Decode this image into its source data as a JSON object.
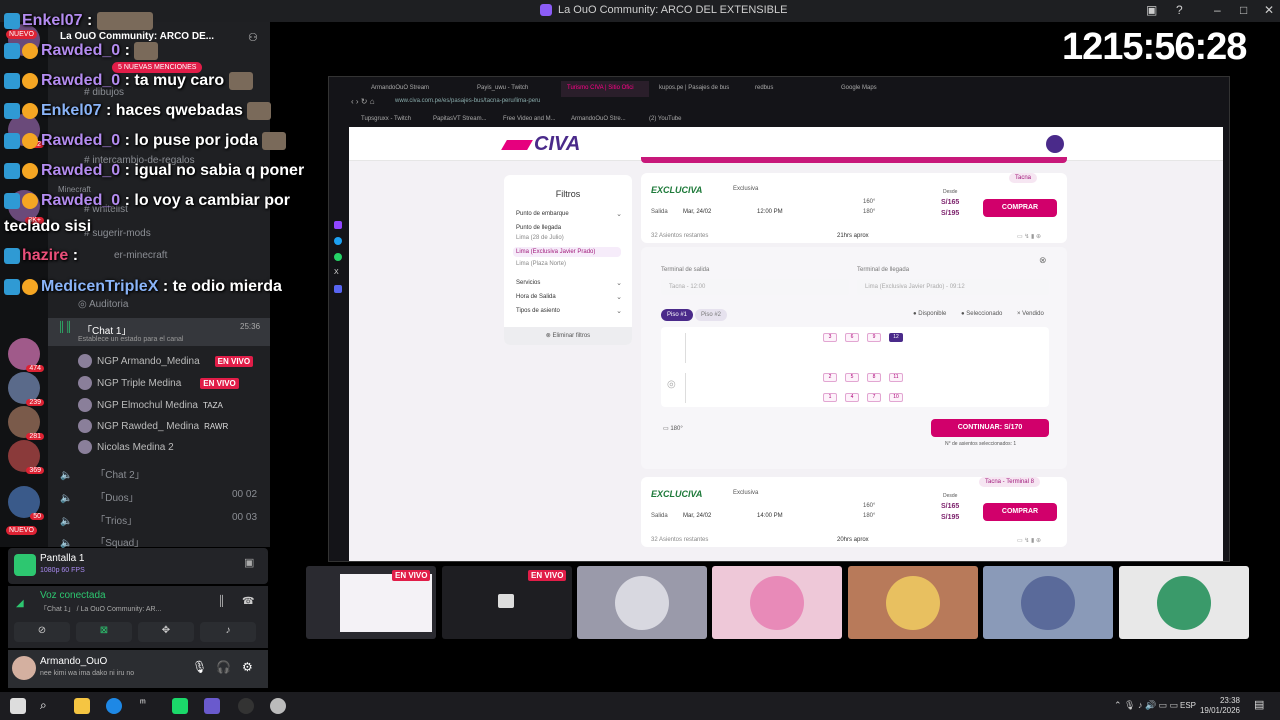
{
  "window": {
    "title": "La OuO Community: ARCO DEL EXTENSIBLE"
  },
  "timer": "1215:56:28",
  "discord": {
    "server_title": "La OuO Community: ARCO DE...",
    "new_badge": "NUEVO",
    "mentions_badge": "5 NUEVAS MENCIONES",
    "channels": [
      "dibujos",
      "intercambio-de-regalos",
      "Minecraft",
      "whitelist",
      "sugerir-mods",
      "er-minecraft",
      "Auditoria"
    ],
    "voice_channel": {
      "name": "「Chat 1」",
      "time": "25:36",
      "status_hint": "Establece un estado para el canal"
    },
    "members": [
      {
        "name": "NGP Armando_Medina",
        "badge": "EN VIVO"
      },
      {
        "name": "NGP Triple Medina",
        "badge": "EN VIVO"
      },
      {
        "name": "NGP Elmochul Medina",
        "tag": "TAZA"
      },
      {
        "name": "NGP Rawded_ Medina",
        "tag": "RAWR"
      },
      {
        "name": "Nicolas Medina 2"
      }
    ],
    "other_channels": [
      {
        "name": "「Chat 2」"
      },
      {
        "name": "「Duos」",
        "count_a": "00",
        "count_b": "02"
      },
      {
        "name": "「Trios」",
        "count_a": "00",
        "count_b": "03"
      },
      {
        "name": "「Squad」"
      }
    ],
    "server_counts": [
      "42",
      "3K+",
      "474",
      "239",
      "281",
      "369",
      "50"
    ],
    "screen_share": {
      "title": "Pantalla 1",
      "quality": "1080p 60 FPS"
    },
    "voice": {
      "status": "Voz conectada",
      "channel": "「Chat 1」 / La OuO Community: AR..."
    },
    "user": {
      "name": "Armando_OuO",
      "status": "nee kimi wa ima dako ni iru no"
    }
  },
  "chat": [
    {
      "user": "Enkel07",
      "text": ":"
    },
    {
      "user": "Rawded_0",
      "text": ":"
    },
    {
      "user": "Rawded_0",
      "text": ": ta muy caro"
    },
    {
      "user": "Enkel07",
      "text": ": haces qwebadas"
    },
    {
      "user": "Rawded_0",
      "text": ": lo puse por joda"
    },
    {
      "user": "Rawded_0",
      "text": ": igual no sabia q poner"
    },
    {
      "user": "Rawded_0",
      "text": ": lo voy a cambiar por"
    },
    {
      "user": "",
      "text": "teclado sisi"
    },
    {
      "user": "hazire",
      "text": ":"
    },
    {
      "user": "MedicenTripleX",
      "text": ": te odio mierda"
    }
  ],
  "browser": {
    "tabs": [
      "ArmandoOuO Stream",
      "Payis_uwu - Twitch",
      "Turismo CIVA | Sitio Ofici",
      "kupos.pe | Pasajes de bus",
      "redbus",
      "Google Maps"
    ],
    "url": "www.civa.com.pe/es/pasajes-bus/tacna-peru/lima-peru",
    "bookmarks": [
      "Tupsgruxx - Twitch",
      "PapitasVT Stream...",
      "Free Video and M...",
      "ArmandoOuO Stre...",
      "(2) YouTube"
    ]
  },
  "civa": {
    "logo": "CIVA",
    "filters": {
      "title": "Filtros",
      "boarding": "Punto de embarque",
      "arrival": "Punto de llegada",
      "options": [
        "Lima (28 de Julio)",
        "Lima (Exclusiva Javier Prado)",
        "Lima (Plaza Norte)"
      ],
      "services": "Servicios",
      "departure_time": "Hora de Salida",
      "seat_type": "Tipos de asiento",
      "clear": "Eliminar filtros"
    },
    "trips": [
      {
        "brand": "EXCLUCIVA",
        "service": "Exclusiva",
        "origin_tag": "Tacna",
        "depart_label": "Salida",
        "date": "Mar, 24/02",
        "time": "12:00 PM",
        "seat_a": "160°",
        "seat_b": "180°",
        "from_label": "Desde",
        "price_a": "S/165",
        "price_b": "S/195",
        "buy": "COMPRAR",
        "seats_left": "32 Asientos restantes",
        "duration": "21hrs aprox"
      },
      {
        "brand": "EXCLUCIVA",
        "service": "Exclusiva",
        "origin_tag": "Tacna - Terminal 8",
        "depart_label": "Salida",
        "date": "Mar, 24/02",
        "time": "14:00 PM",
        "seat_a": "160°",
        "seat_b": "180°",
        "from_label": "Desde",
        "price_a": "S/165",
        "price_b": "S/195",
        "buy": "COMPRAR",
        "seats_left": "32 Asientos restantes",
        "duration": "20hrs aprox"
      }
    ],
    "seat_picker": {
      "from_label": "Terminal de salida",
      "from_value": "Tacna - 12:00",
      "to_label": "Terminal de llegada",
      "to_value": "Lima (Exclusiva Javier Prado) - 09:12",
      "floor1": "Piso #1",
      "floor2": "Piso #2",
      "legend": [
        "Disponible",
        "Seleccionado",
        "Vendido"
      ],
      "seat_numbers_top": [
        "3",
        "6",
        "9",
        "12"
      ],
      "seat_numbers_mid": [
        "2",
        "5",
        "8",
        "11"
      ],
      "seat_numbers_bot": [
        "1",
        "4",
        "7",
        "10"
      ],
      "recline": "180°",
      "continue": "CONTINUAR: S/170",
      "selected_count": "N° de asientos seleccionados: 1"
    }
  },
  "taskbar": {
    "lang": "ESP",
    "time": "23:38",
    "date": "19/01/2026"
  },
  "thumbs": {
    "live": "EN VIVO"
  }
}
